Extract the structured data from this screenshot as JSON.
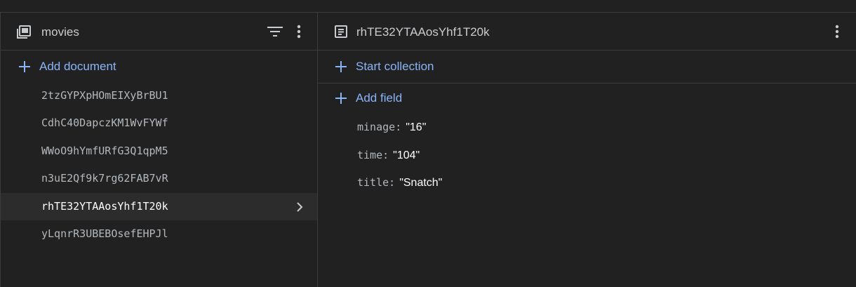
{
  "collection": {
    "name": "movies",
    "add_document_label": "Add document",
    "documents": [
      {
        "id": "2tzGYPXpHOmEIXyBrBU1"
      },
      {
        "id": "CdhC40DapczKM1WvFYWf"
      },
      {
        "id": "WWoO9hYmfURfG3Q1qpM5"
      },
      {
        "id": "n3uE2Qf9k7rg62FAB7vR"
      },
      {
        "id": "rhTE32YTAAosYhf1T20k"
      },
      {
        "id": "yLqnrR3UBEBOsefEHPJl"
      }
    ],
    "selected_index": 4
  },
  "document": {
    "id": "rhTE32YTAAosYhf1T20k",
    "start_collection_label": "Start collection",
    "add_field_label": "Add field",
    "fields": [
      {
        "key": "minage",
        "value": "\"16\""
      },
      {
        "key": "time",
        "value": "\"104\""
      },
      {
        "key": "title",
        "value": "\"Snatch\""
      }
    ]
  },
  "colors": {
    "background": "#212121",
    "accent": "#8ab4f8",
    "border": "#3c3c3c",
    "selected_row": "#2c2c2c"
  },
  "icons": {
    "collection": "collection-stack-icon",
    "filter": "filter-icon",
    "more": "more-vert-icon",
    "document": "document-icon",
    "add": "plus-icon",
    "chevron": "chevron-right-icon"
  }
}
